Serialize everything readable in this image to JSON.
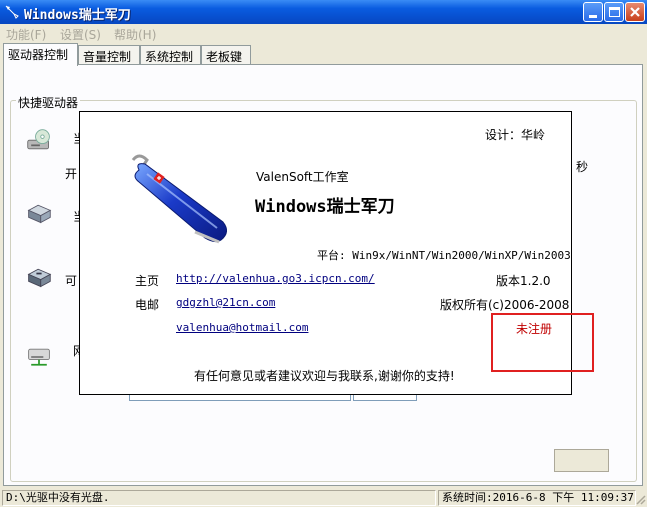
{
  "window": {
    "title": "Windows瑞士军刀"
  },
  "menu": [
    {
      "label": "功能(F)"
    },
    {
      "label": "设置(S)"
    },
    {
      "label": "帮助(H)"
    }
  ],
  "tabs": [
    {
      "label": "驱动器控制"
    },
    {
      "label": "音量控制"
    },
    {
      "label": "系统控制"
    },
    {
      "label": "老板键"
    }
  ],
  "group": {
    "label": "快捷驱动器"
  },
  "background_fragments": {
    "row1": "当",
    "row1b": "开",
    "row2": "当",
    "row3": "可",
    "row4": "网",
    "right": "秒"
  },
  "about": {
    "designer": "设计：华岭",
    "studio": "ValenSoft工作室",
    "product": "Windows瑞士军刀",
    "platform": "平台: Win9x/WinNT/Win2000/WinXP/Win2003",
    "homepage_label": "主页",
    "homepage_url": "http://valenhua.go3.icpcn.com/",
    "version": "版本1.2.0",
    "email_label": "电邮",
    "email1": "gdgzhl@21cn.com",
    "copyright": "版权所有(c)2006-2008",
    "email2": "valenhua@hotmail.com",
    "registration": "未注册",
    "feedback": "有任何意见或者建议欢迎与我联系,谢谢你的支持!"
  },
  "status": {
    "message": "D:\\光驱中没有光盘.",
    "time": "系统时间:2016-6-8  下午 11:09:37"
  },
  "colors": {
    "titlebar": "#0a5ce0",
    "link": "#00007f",
    "unregistered": "#c00000",
    "highlight_box": "#e02020"
  }
}
